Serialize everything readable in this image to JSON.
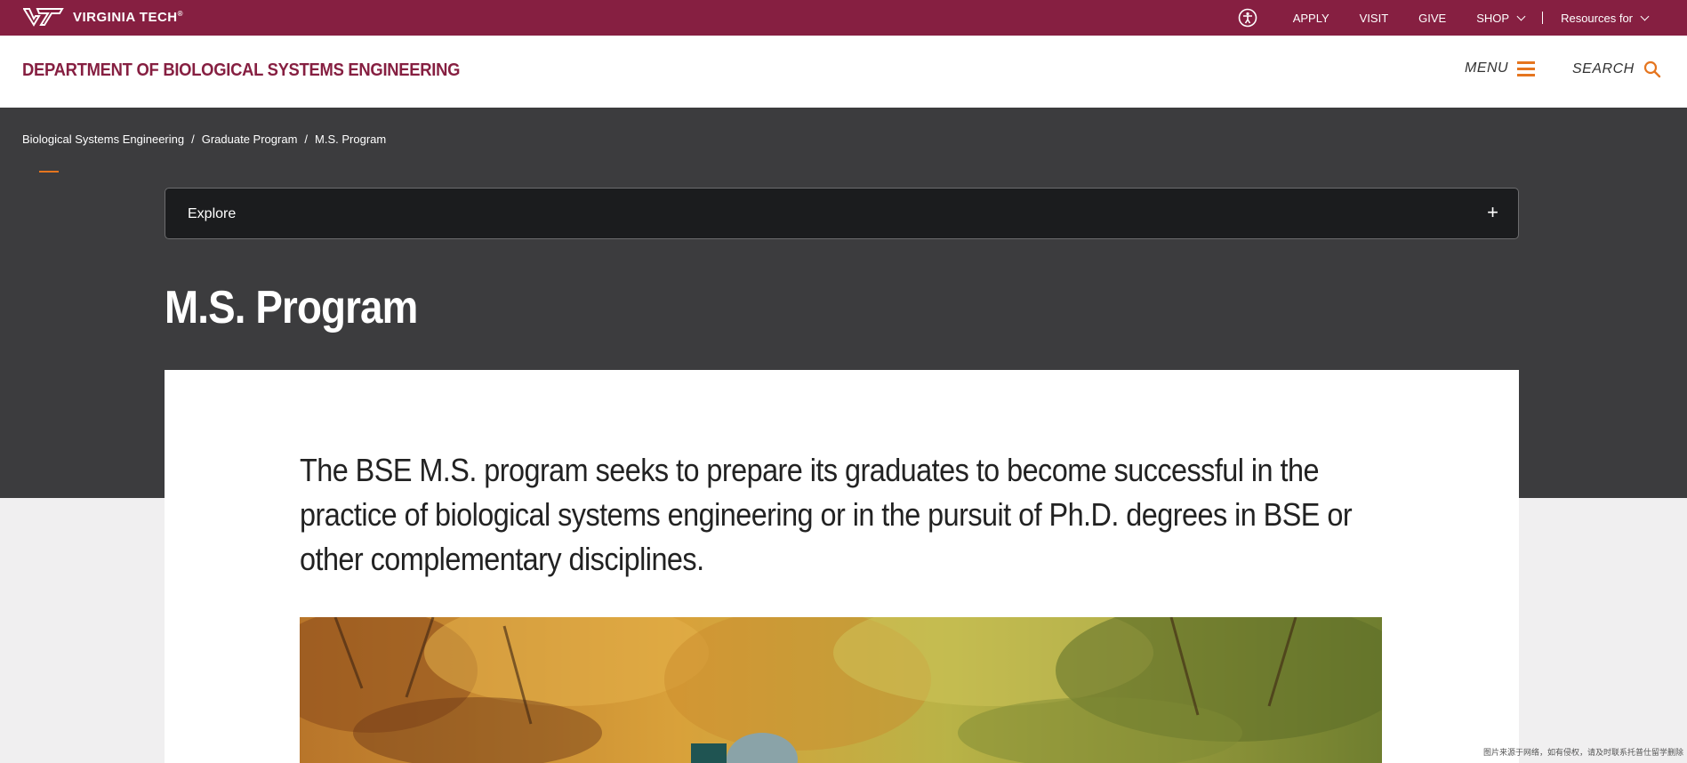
{
  "topbar": {
    "logo_text": "VIRGINIA TECH",
    "logo_mark": "®",
    "nav": {
      "apply": "APPLY",
      "visit": "VISIT",
      "give": "GIVE",
      "shop": "SHOP",
      "resources": "Resources for"
    }
  },
  "header": {
    "dept_title": "DEPARTMENT OF BIOLOGICAL SYSTEMS ENGINEERING",
    "menu_label": "MENU",
    "search_label": "SEARCH"
  },
  "breadcrumb": [
    "Biological Systems Engineering",
    "Graduate Program",
    "M.S. Program"
  ],
  "explore": {
    "label": "Explore",
    "toggle": "+"
  },
  "page": {
    "title": "M.S. Program",
    "intro": "The BSE M.S. program seeks to prepare its graduates to become successful in the practice of biological systems engineering or in the pursuit of Ph.D. degrees in BSE or other complementary disciplines."
  },
  "footnote": "图片来源于网络，如有侵权，请及时联系托普仕留学删除",
  "colors": {
    "maroon": "#861f41",
    "orange": "#e5751f",
    "hero": "#3c3c3e"
  }
}
